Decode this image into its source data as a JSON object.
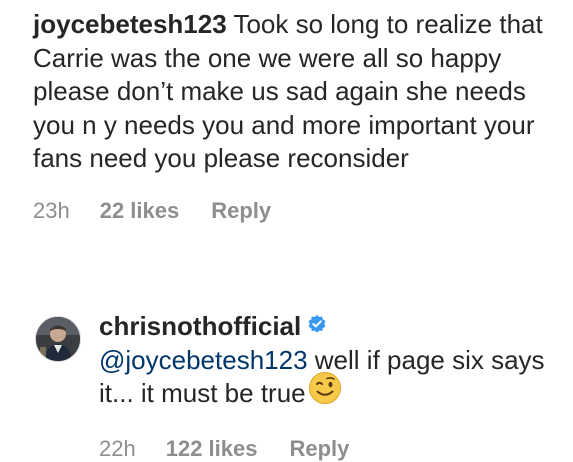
{
  "comment": {
    "username": "joycebetesh123",
    "text": "Took so long to realize that Carrie was the one we were all so happy please don’t make us sad again she needs you n y needs you and more important your fans need you please reconsider",
    "time": "23h",
    "likes": "22 likes",
    "reply_label": "Reply"
  },
  "reply": {
    "username": "chrisnothofficial",
    "verified": true,
    "mention": "@joycebetesh123",
    "text": "well if page six says it... it must be true",
    "emoji": "winking-face",
    "time": "22h",
    "likes": "122 likes",
    "reply_label": "Reply"
  },
  "colors": {
    "text": "#262626",
    "secondary": "#8e8e8e",
    "mention": "#00376b",
    "verified": "#3897f0"
  }
}
